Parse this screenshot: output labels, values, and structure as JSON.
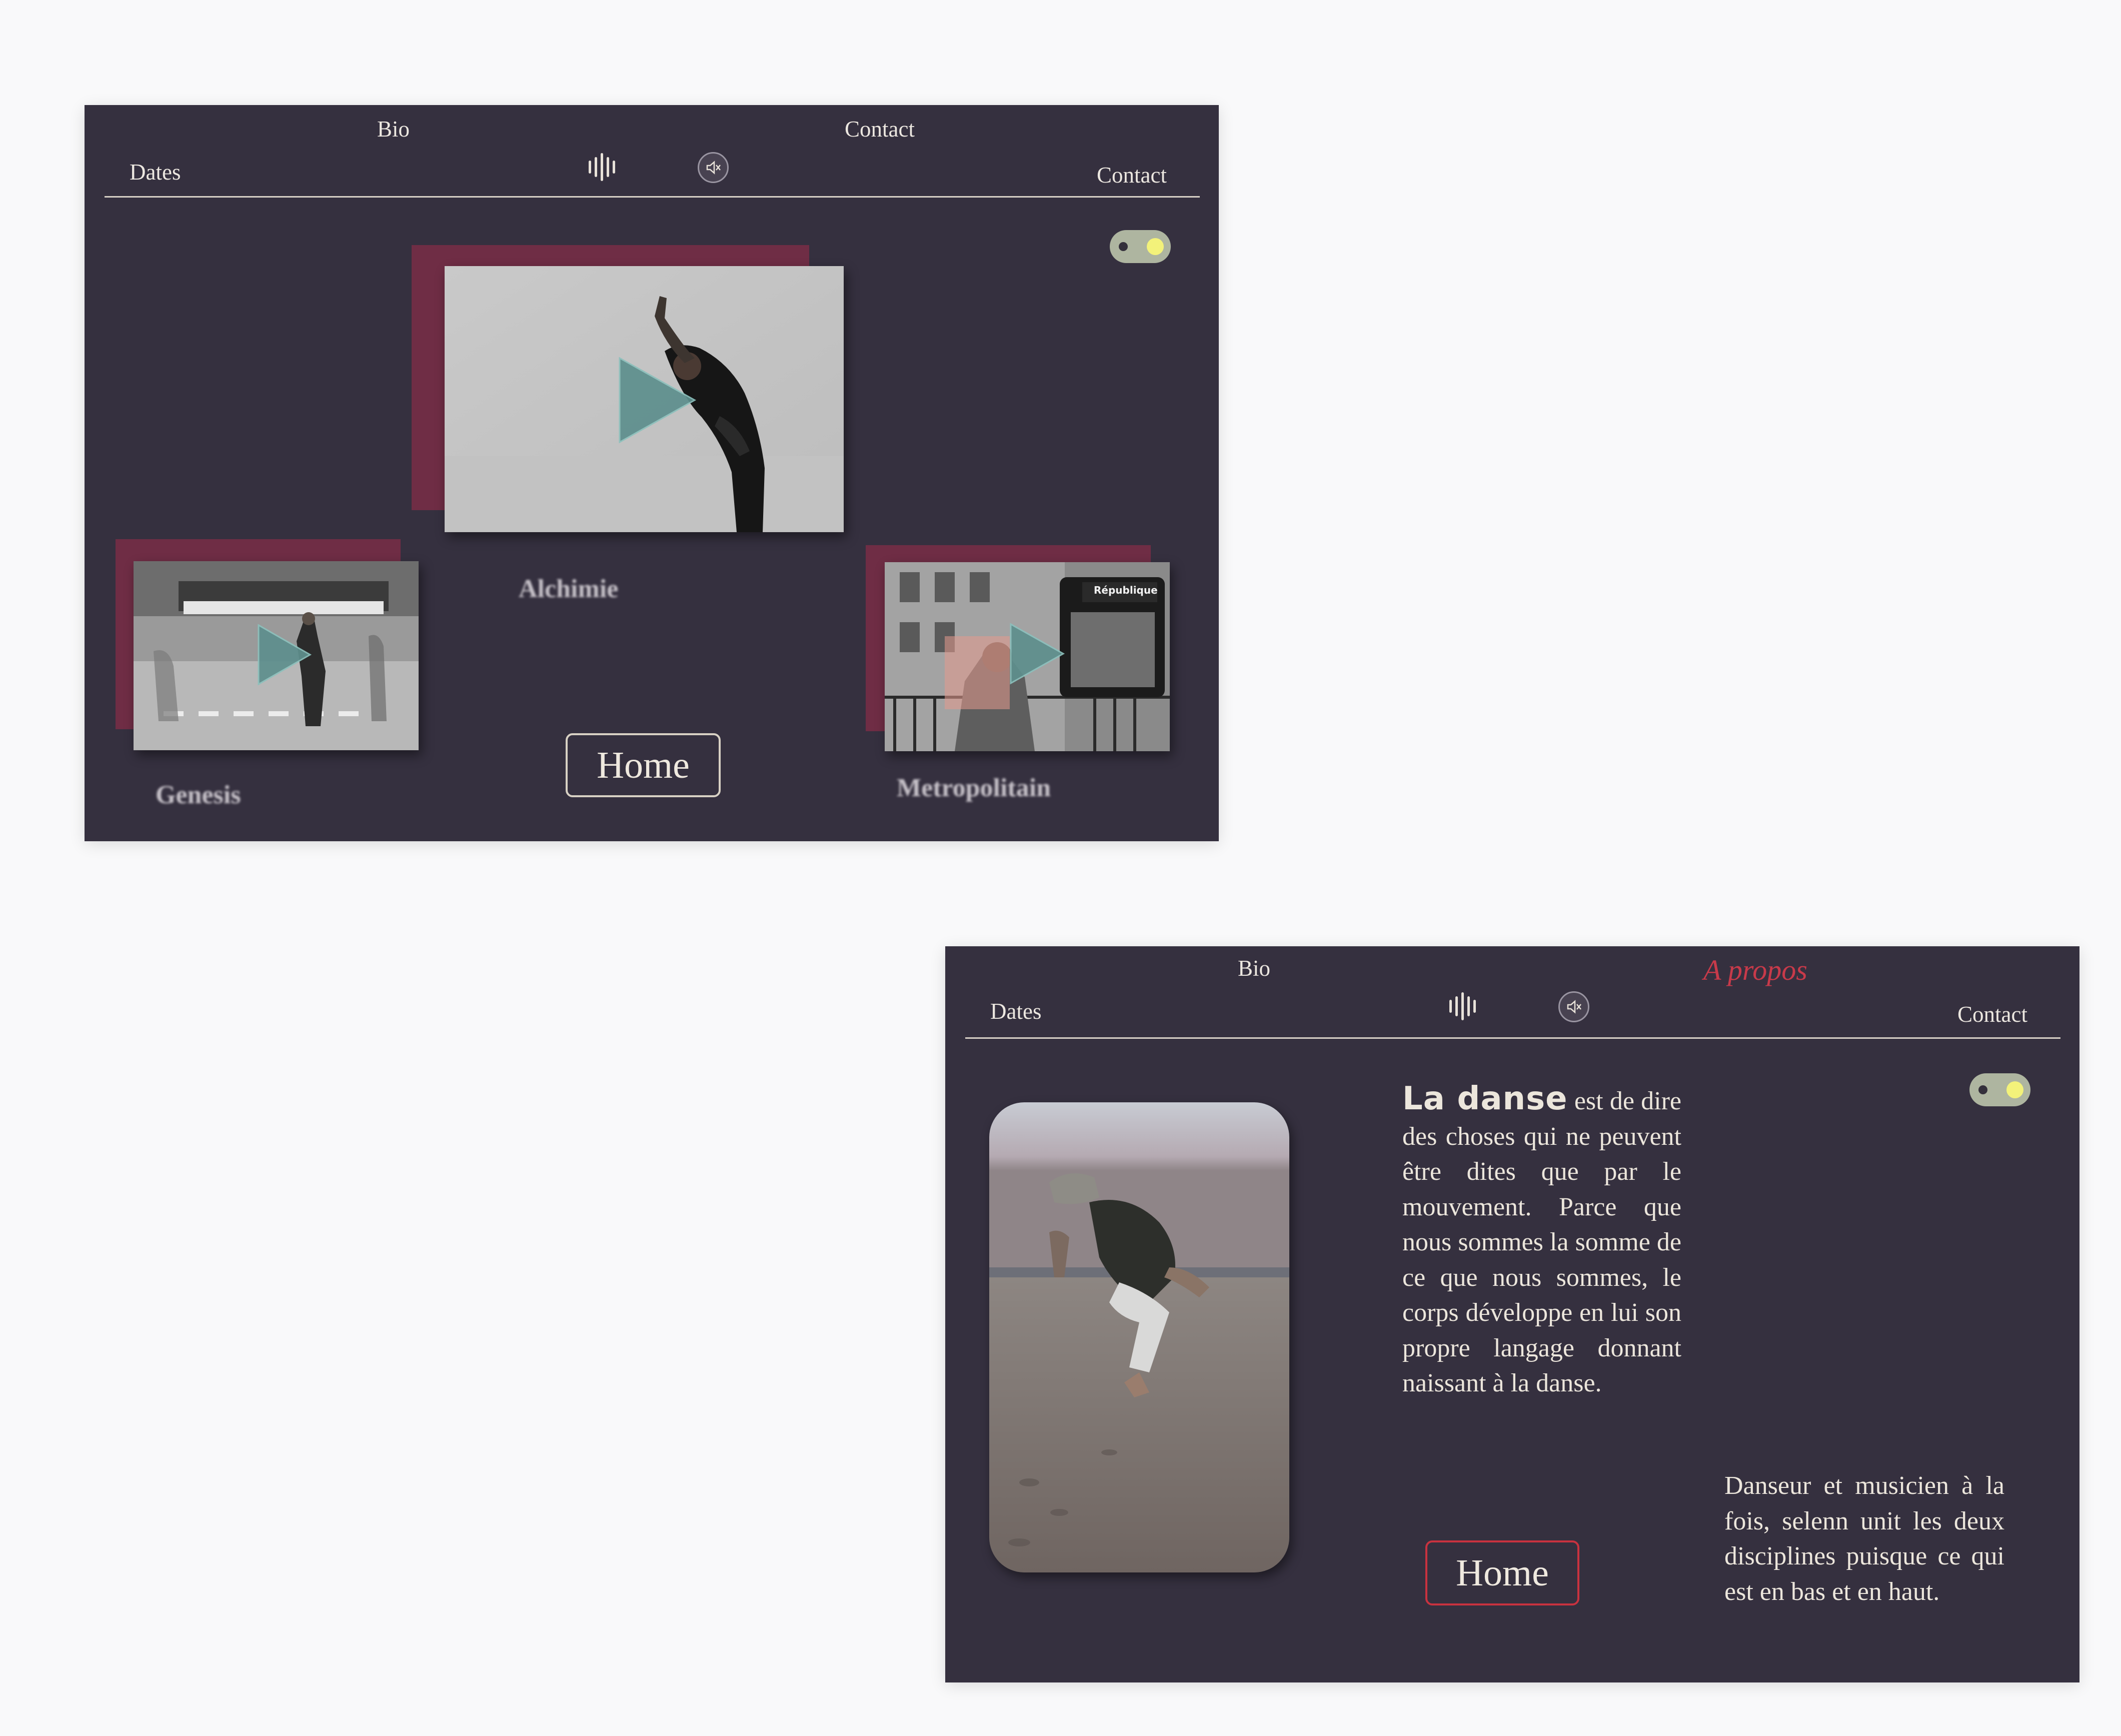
{
  "screen_home": {
    "nav": {
      "bio": "Bio",
      "contact_top": "Contact",
      "dates": "Dates",
      "contact_right": "Contact"
    },
    "icons": {
      "sound": "sound-wave-icon",
      "mute": "speaker-mute-icon",
      "toggle": "theme-toggle"
    },
    "projects": [
      {
        "title": "Alchimie"
      },
      {
        "title": "Genesis"
      },
      {
        "title": "Metropolitain",
        "sign_text": "République"
      }
    ],
    "home_label": "Home"
  },
  "screen_about": {
    "nav": {
      "bio": "Bio",
      "apropos": "A propos",
      "dates": "Dates",
      "contact": "Contact"
    },
    "lead": "La danse",
    "paragraph": "est de dire des choses qui ne peuvent être dites que par le mouvement. Parce que nous sommes la somme de ce que nous sommes, le corps développe en lui son propre langage donnant naissant à la danse.",
    "side_text": "Danseur et musicien à la fois, selenn unit les deux disciplines puisque ce qui est en bas et en haut.",
    "home_label": "Home"
  },
  "colors": {
    "background": "#35303f",
    "accent_red": "#c83a4a",
    "frame_burgundy": "#6f2d45",
    "play_teal": "#5e8f8d",
    "toggle_track": "#aeb5a0",
    "toggle_knob": "#f3f27a"
  }
}
